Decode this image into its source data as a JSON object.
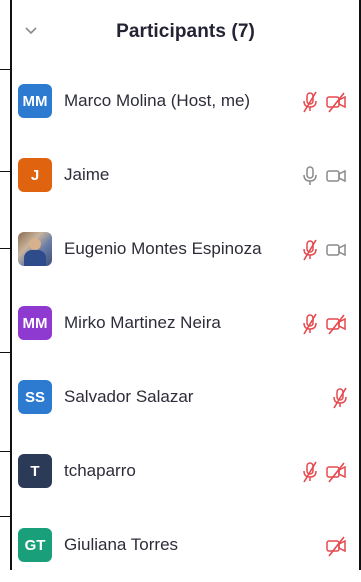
{
  "header": {
    "title": "Participants (7)"
  },
  "colors": {
    "muted": "#e5484d",
    "icon_on": "#8a8a8a"
  },
  "participants": [
    {
      "initials": "MM",
      "name": "Marco Molina (Host, me)",
      "avatar_color": "#2d7bd1",
      "photo": false,
      "mic": "muted",
      "video": "off"
    },
    {
      "initials": "J",
      "name": "Jaime",
      "avatar_color": "#e06310",
      "photo": false,
      "mic": "on",
      "video": "on"
    },
    {
      "initials": "",
      "name": "Eugenio Montes Espinoza",
      "avatar_color": "",
      "photo": true,
      "mic": "muted",
      "video": "on"
    },
    {
      "initials": "MM",
      "name": "Mirko Martinez Neira",
      "avatar_color": "#8e3ad1",
      "photo": false,
      "mic": "muted",
      "video": "off"
    },
    {
      "initials": "SS",
      "name": "Salvador Salazar",
      "avatar_color": "#2d7bd1",
      "photo": false,
      "mic": "muted",
      "video": "none"
    },
    {
      "initials": "T",
      "name": "tchaparro",
      "avatar_color": "#2b3a57",
      "photo": false,
      "mic": "muted",
      "video": "off"
    },
    {
      "initials": "GT",
      "name": "Giuliana Torres",
      "avatar_color": "#19a07a",
      "photo": false,
      "mic": "none",
      "video": "off"
    }
  ]
}
